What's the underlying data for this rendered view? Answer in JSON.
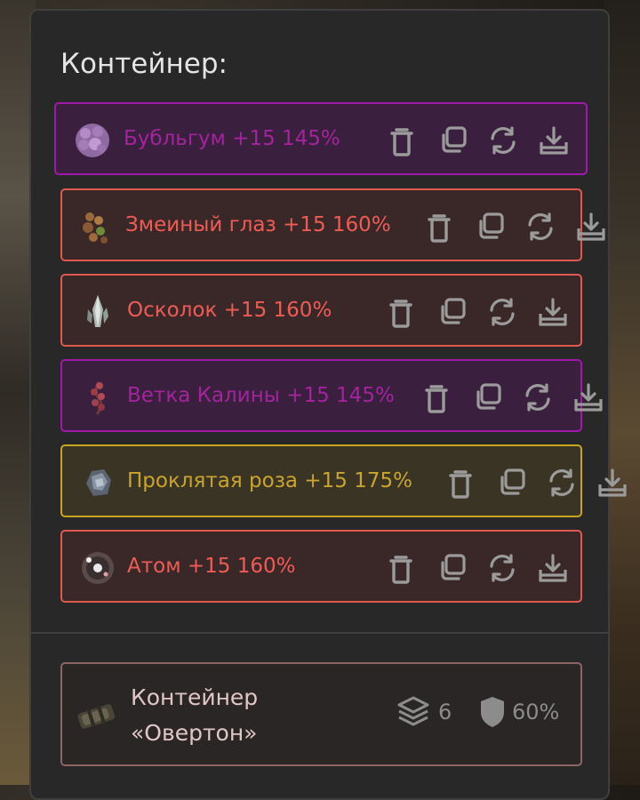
{
  "panel": {
    "title": "Контейнер:"
  },
  "items": [
    {
      "name": "Бубльгум +15 145%",
      "color": "#a3249d",
      "border": "#a019a8",
      "bg": "#3a1f3e",
      "icon": "bubblegum-icon"
    },
    {
      "name": "Змеиный глаз +15 160%",
      "color": "#ef5b55",
      "border": "#e0594e",
      "bg": "#3a2828",
      "icon": "snake-eye-icon"
    },
    {
      "name": "Осколок +15 160%",
      "color": "#ef5b55",
      "border": "#e0594e",
      "bg": "#3a2828",
      "icon": "shard-icon"
    },
    {
      "name": "Ветка Калины +15 145%",
      "color": "#a3249d",
      "border": "#a019a8",
      "bg": "#3a1f3e",
      "icon": "viburnum-icon"
    },
    {
      "name": "Проклятая роза +15 175%",
      "color": "#caa42c",
      "border": "#c9a41e",
      "bg": "#3a3424",
      "icon": "cursed-rose-icon"
    },
    {
      "name": "Атом +15 160%",
      "color": "#ef5b55",
      "border": "#e0594e",
      "bg": "#3a2828",
      "icon": "atom-icon"
    }
  ],
  "actions": [
    "trash-icon",
    "copy-icon",
    "refresh-icon",
    "download-icon"
  ],
  "container": {
    "name": "Контейнер «Овертон»",
    "slots": "6",
    "protection": "60%"
  }
}
